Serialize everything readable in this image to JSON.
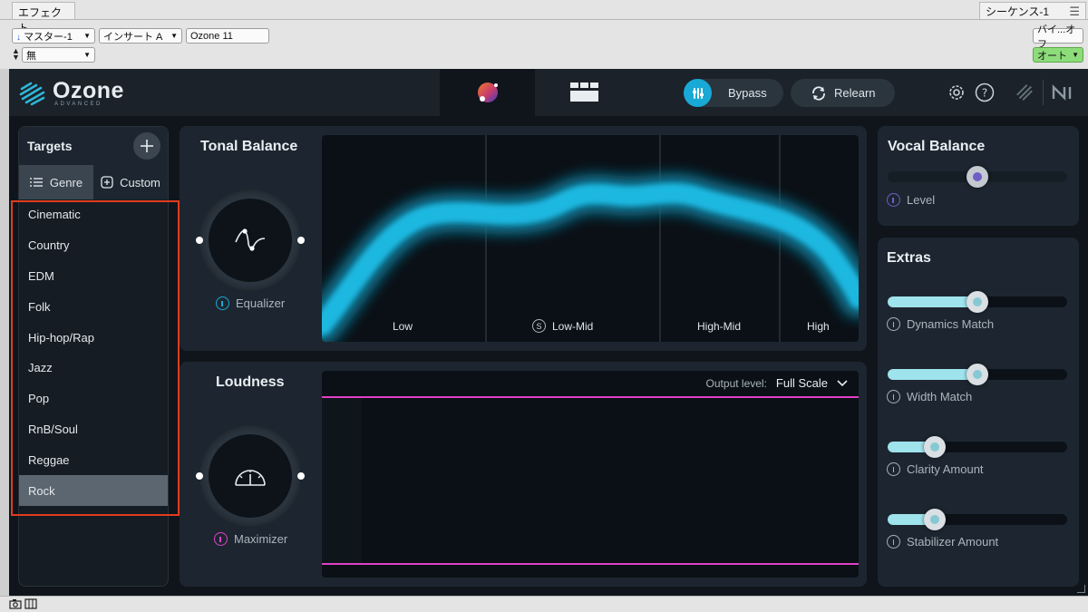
{
  "host": {
    "tab_effect": "エフェクト",
    "tab_sequence": "シーケンス-1",
    "master_select": "マスター-1",
    "insert_select": "インサート A",
    "plugin_name_field": "Ozone 11",
    "preset_select": "無",
    "bypass_toggle": "バイ...オフ",
    "auto_toggle": "オート"
  },
  "header": {
    "logo_name": "Ozone",
    "logo_sub": "ADVANCED",
    "bypass_label": "Bypass",
    "relearn_label": "Relearn"
  },
  "targets": {
    "title": "Targets",
    "genre_tab": "Genre",
    "custom_tab": "Custom",
    "items": [
      "Cinematic",
      "Country",
      "EDM",
      "Folk",
      "Hip-hop/Rap",
      "Jazz",
      "Pop",
      "RnB/Soul",
      "Reggae",
      "Rock"
    ],
    "selected": "Rock"
  },
  "tonal_balance": {
    "title": "Tonal Balance",
    "module": "Equalizer",
    "bands": [
      "Low",
      "Low-Mid",
      "High-Mid",
      "High"
    ],
    "solo_badge": "S"
  },
  "loudness": {
    "title": "Loudness",
    "module": "Maximizer",
    "output_label": "Output level:",
    "output_value": "Full Scale"
  },
  "vocal_balance": {
    "title": "Vocal Balance",
    "level_label": "Level",
    "level_value": 0.5
  },
  "extras": {
    "title": "Extras",
    "sliders": [
      {
        "label": "Dynamics Match",
        "value": 0.5
      },
      {
        "label": "Width Match",
        "value": 0.5
      },
      {
        "label": "Clarity Amount",
        "value": 0.26
      },
      {
        "label": "Stabilizer Amount",
        "value": 0.26
      }
    ]
  },
  "colors": {
    "accent_cyan": "#18a9d6",
    "curve": "#1fb8e0",
    "maximizer": "#e040c8",
    "highlight": "#e23b1f"
  }
}
